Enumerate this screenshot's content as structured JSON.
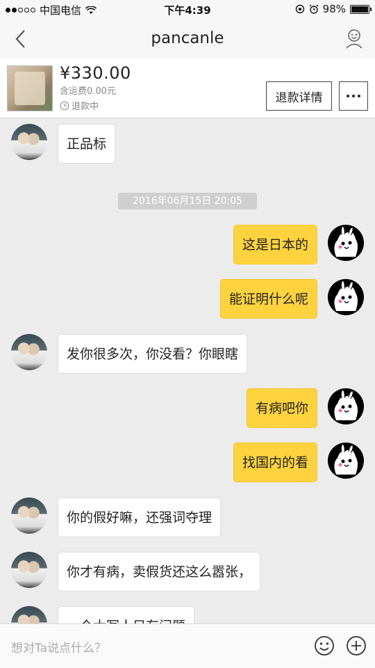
{
  "status_bar": {
    "carrier": "中国电信",
    "time": "下午4:39",
    "battery": "98%"
  },
  "nav": {
    "title": "pancanle"
  },
  "product": {
    "price": "¥330.00",
    "shipping": "含运费0.00元",
    "status": "退款中",
    "refund_button": "退款详情"
  },
  "messages": [
    {
      "side": "in",
      "text": "正品标"
    },
    {
      "side": "out",
      "text": "这是日本的"
    },
    {
      "side": "out",
      "text": "能证明什么呢"
    },
    {
      "side": "in",
      "text": "发你很多次，你没看？你眼瞎"
    },
    {
      "side": "out",
      "text": "有病吧你"
    },
    {
      "side": "out",
      "text": "找国内的看"
    },
    {
      "side": "in",
      "text": "你的假好嘛，还强词夺理"
    },
    {
      "side": "in",
      "text": "你才有病，卖假货还这么嚣张，"
    },
    {
      "side": "in",
      "text": "一个大写人只有问题"
    }
  ],
  "timestamp": "2016年06月15日 20:05",
  "input": {
    "placeholder": "想对Ta说点什么？"
  }
}
